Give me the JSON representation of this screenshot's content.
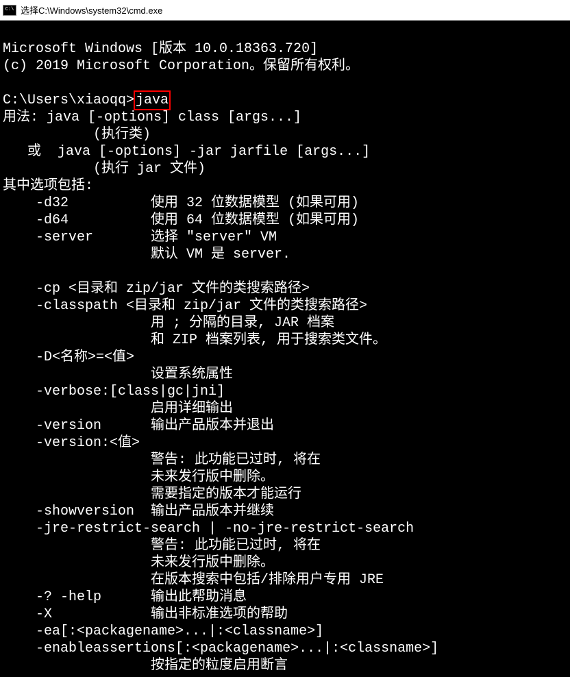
{
  "titlebar": {
    "text": "选择C:\\Windows\\system32\\cmd.exe"
  },
  "terminal": {
    "lines": [
      "",
      "Microsoft Windows [版本 10.0.18363.720]",
      "(c) 2019 Microsoft Corporation。保留所有权利。",
      "",
      {
        "prompt": "C:\\Users\\xiaoqq>",
        "cmd": "java"
      },
      "用法: java [-options] class [args...]",
      "           (执行类)",
      "   或  java [-options] -jar jarfile [args...]",
      "           (执行 jar 文件)",
      "其中选项包括:",
      "    -d32          使用 32 位数据模型 (如果可用)",
      "    -d64          使用 64 位数据模型 (如果可用)",
      "    -server       选择 \"server\" VM",
      "                  默认 VM 是 server.",
      "",
      "    -cp <目录和 zip/jar 文件的类搜索路径>",
      "    -classpath <目录和 zip/jar 文件的类搜索路径>",
      "                  用 ; 分隔的目录, JAR 档案",
      "                  和 ZIP 档案列表, 用于搜索类文件。",
      "    -D<名称>=<值>",
      "                  设置系统属性",
      "    -verbose:[class|gc|jni]",
      "                  启用详细输出",
      "    -version      输出产品版本并退出",
      "    -version:<值>",
      "                  警告: 此功能已过时, 将在",
      "                  未来发行版中删除。",
      "                  需要指定的版本才能运行",
      "    -showversion  输出产品版本并继续",
      "    -jre-restrict-search | -no-jre-restrict-search",
      "                  警告: 此功能已过时, 将在",
      "                  未来发行版中删除。",
      "                  在版本搜索中包括/排除用户专用 JRE",
      "    -? -help      输出此帮助消息",
      "    -X            输出非标准选项的帮助",
      "    -ea[:<packagename>...|:<classname>]",
      "    -enableassertions[:<packagename>...|:<classname>]",
      "                  按指定的粒度启用断言"
    ]
  }
}
